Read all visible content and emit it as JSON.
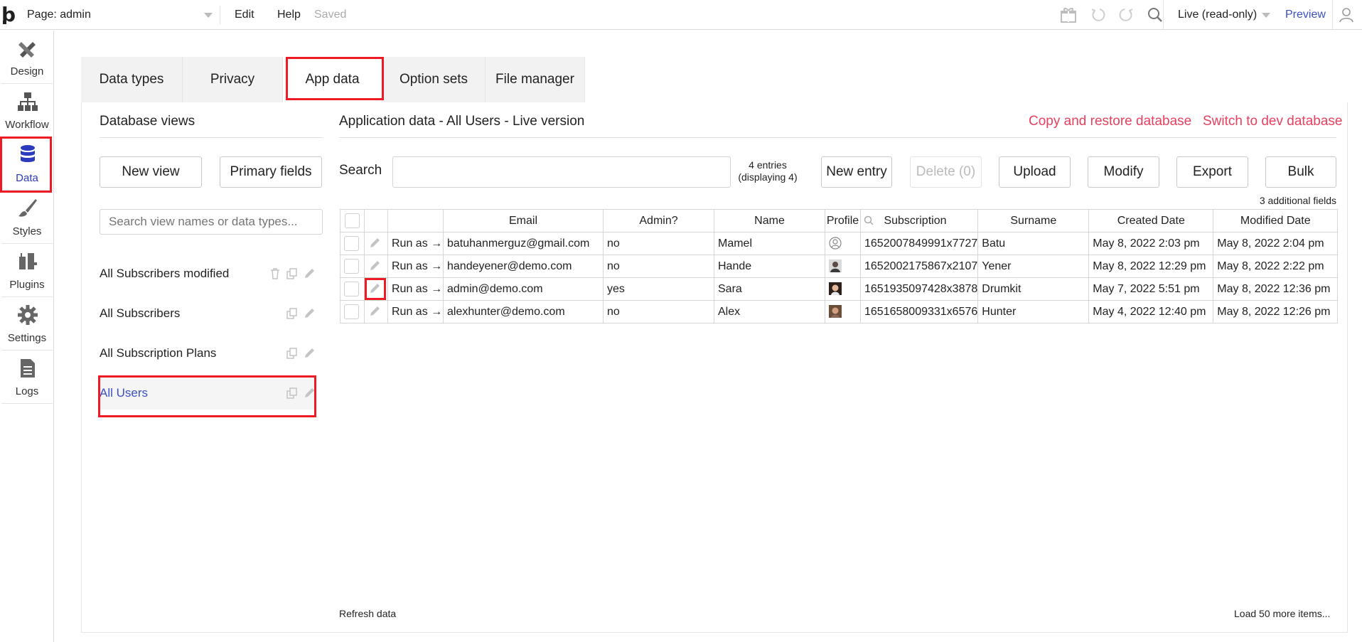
{
  "topbar": {
    "page_label": "Page: admin",
    "menu_edit": "Edit",
    "menu_help": "Help",
    "save_status": "Saved",
    "version_select": "Live (read-only)",
    "preview": "Preview"
  },
  "leftnav": {
    "items": [
      {
        "label": "Design",
        "icon": "design-icon"
      },
      {
        "label": "Workflow",
        "icon": "workflow-icon"
      },
      {
        "label": "Data",
        "icon": "database-icon"
      },
      {
        "label": "Styles",
        "icon": "brush-icon"
      },
      {
        "label": "Plugins",
        "icon": "plugin-icon"
      },
      {
        "label": "Settings",
        "icon": "gear-icon"
      },
      {
        "label": "Logs",
        "icon": "logs-icon"
      }
    ],
    "active": "Data"
  },
  "tabs": [
    "Data types",
    "Privacy",
    "App data",
    "Option sets",
    "File manager"
  ],
  "active_tab": "App data",
  "db_views": {
    "title": "Database views",
    "new_view": "New view",
    "primary_fields": "Primary fields",
    "search_placeholder": "Search view names or data types...",
    "items": [
      "All Subscribers modified",
      "All Subscribers",
      "All Subscription Plans",
      "All Users"
    ],
    "selected": "All Users"
  },
  "app_data": {
    "title": "Application data - All Users - Live version",
    "copy_restore": "Copy and restore database",
    "switch_dev": "Switch to dev database",
    "search_label": "Search",
    "entries_line1": "4 entries",
    "entries_line2": "(displaying 4)",
    "buttons": {
      "new_entry": "New entry",
      "delete": "Delete (0)",
      "upload": "Upload",
      "modify": "Modify",
      "export": "Export",
      "bulk": "Bulk"
    },
    "additional_fields": "3 additional fields",
    "columns": [
      "Email",
      "Admin?",
      "Name",
      "Profile",
      "Subscription",
      "Surname",
      "Created Date",
      "Modified Date"
    ],
    "run_as": "Run as →",
    "rows": [
      {
        "email": "batuhanmerguz@gmail.com",
        "admin": "no",
        "name": "Mamel",
        "subscription": "1652007849991x7727",
        "surname": "Batu",
        "created": "May 8, 2022 2:03 pm",
        "modified": "May 8, 2022 2:04 pm"
      },
      {
        "email": "handeyener@demo.com",
        "admin": "no",
        "name": "Hande",
        "subscription": "1652002175867x2107",
        "surname": "Yener",
        "created": "May 8, 2022 12:29 pm",
        "modified": "May 8, 2022 2:22 pm"
      },
      {
        "email": "admin@demo.com",
        "admin": "yes",
        "name": "Sara",
        "subscription": "1651935097428x3878",
        "surname": "Drumkit",
        "created": "May 7, 2022 5:51 pm",
        "modified": "May 8, 2022 12:36 pm"
      },
      {
        "email": "alexhunter@demo.com",
        "admin": "no",
        "name": "Alex",
        "subscription": "1651658009331x6576",
        "surname": "Hunter",
        "created": "May 4, 2022 12:40 pm",
        "modified": "May 8, 2022 12:26 pm"
      }
    ],
    "refresh": "Refresh data",
    "load_more": "Load 50 more items..."
  },
  "colors": {
    "accent_link": "#3b4fc5",
    "danger_link": "#e8405f",
    "highlight": "#ee1b24"
  }
}
